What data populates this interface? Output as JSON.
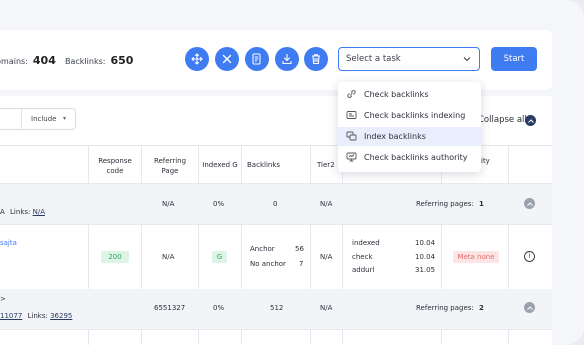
{
  "toolbar": {
    "domains_label": "Domains:",
    "domains_value": "404",
    "backlinks_label": "Backlinks:",
    "backlinks_value": "650",
    "select_placeholder": "Select a task",
    "start_label": "Start"
  },
  "task_menu": {
    "items": [
      {
        "label": "Check backlinks",
        "icon": "link-icon"
      },
      {
        "label": "Check backlinks indexing",
        "icon": "indexing-icon"
      },
      {
        "label": "Index backlinks",
        "icon": "index-icon"
      },
      {
        "label": "Check backlinks authority",
        "icon": "authority-icon"
      }
    ],
    "active_index": 2
  },
  "filters": {
    "include_label": "Include",
    "collapse_label": "Collapse all"
  },
  "table": {
    "headers": {
      "response_code": "Response code",
      "referring_page": "Referring Page",
      "indexed_g": "Indexed G",
      "backlinks": "Backlinks",
      "tier2": "Tier2",
      "quality": "ing lity"
    },
    "rows": [
      {
        "left": "A",
        "links_label": "Links:",
        "links_value": "N/A",
        "referring_page": "N/A",
        "indexed": "0%",
        "backlinks": "0",
        "tier2": "N/A",
        "referring_pages_label": "Referring pages:",
        "referring_pages_value": "1"
      },
      {
        "left_link": "sajta",
        "response_code": "200",
        "referring_page": "N/A",
        "indexed": "G",
        "anchor_label": "Anchor",
        "anchor_value": "56",
        "no_anchor_label": "No anchor",
        "no_anchor_value": "7",
        "tier2": "N/A",
        "stats": [
          {
            "label": "indexed",
            "value": "10.04"
          },
          {
            "label": "check",
            "value": "10.04"
          },
          {
            "label": "addurl",
            "value": "31.05"
          }
        ],
        "meta": "Meta none"
      },
      {
        "left": ">",
        "left_num": "11077",
        "links_label": "Links:",
        "links_value": "36295",
        "referring_page": "6551327",
        "indexed": "0%",
        "backlinks": "512",
        "tier2": "N/A",
        "referring_pages_label": "Referring pages:",
        "referring_pages_value": "2"
      }
    ]
  },
  "colors": {
    "accent": "#3f7bf1",
    "dark": "#2a3b66",
    "green": "#2eab5c",
    "red": "#e46b6b"
  }
}
